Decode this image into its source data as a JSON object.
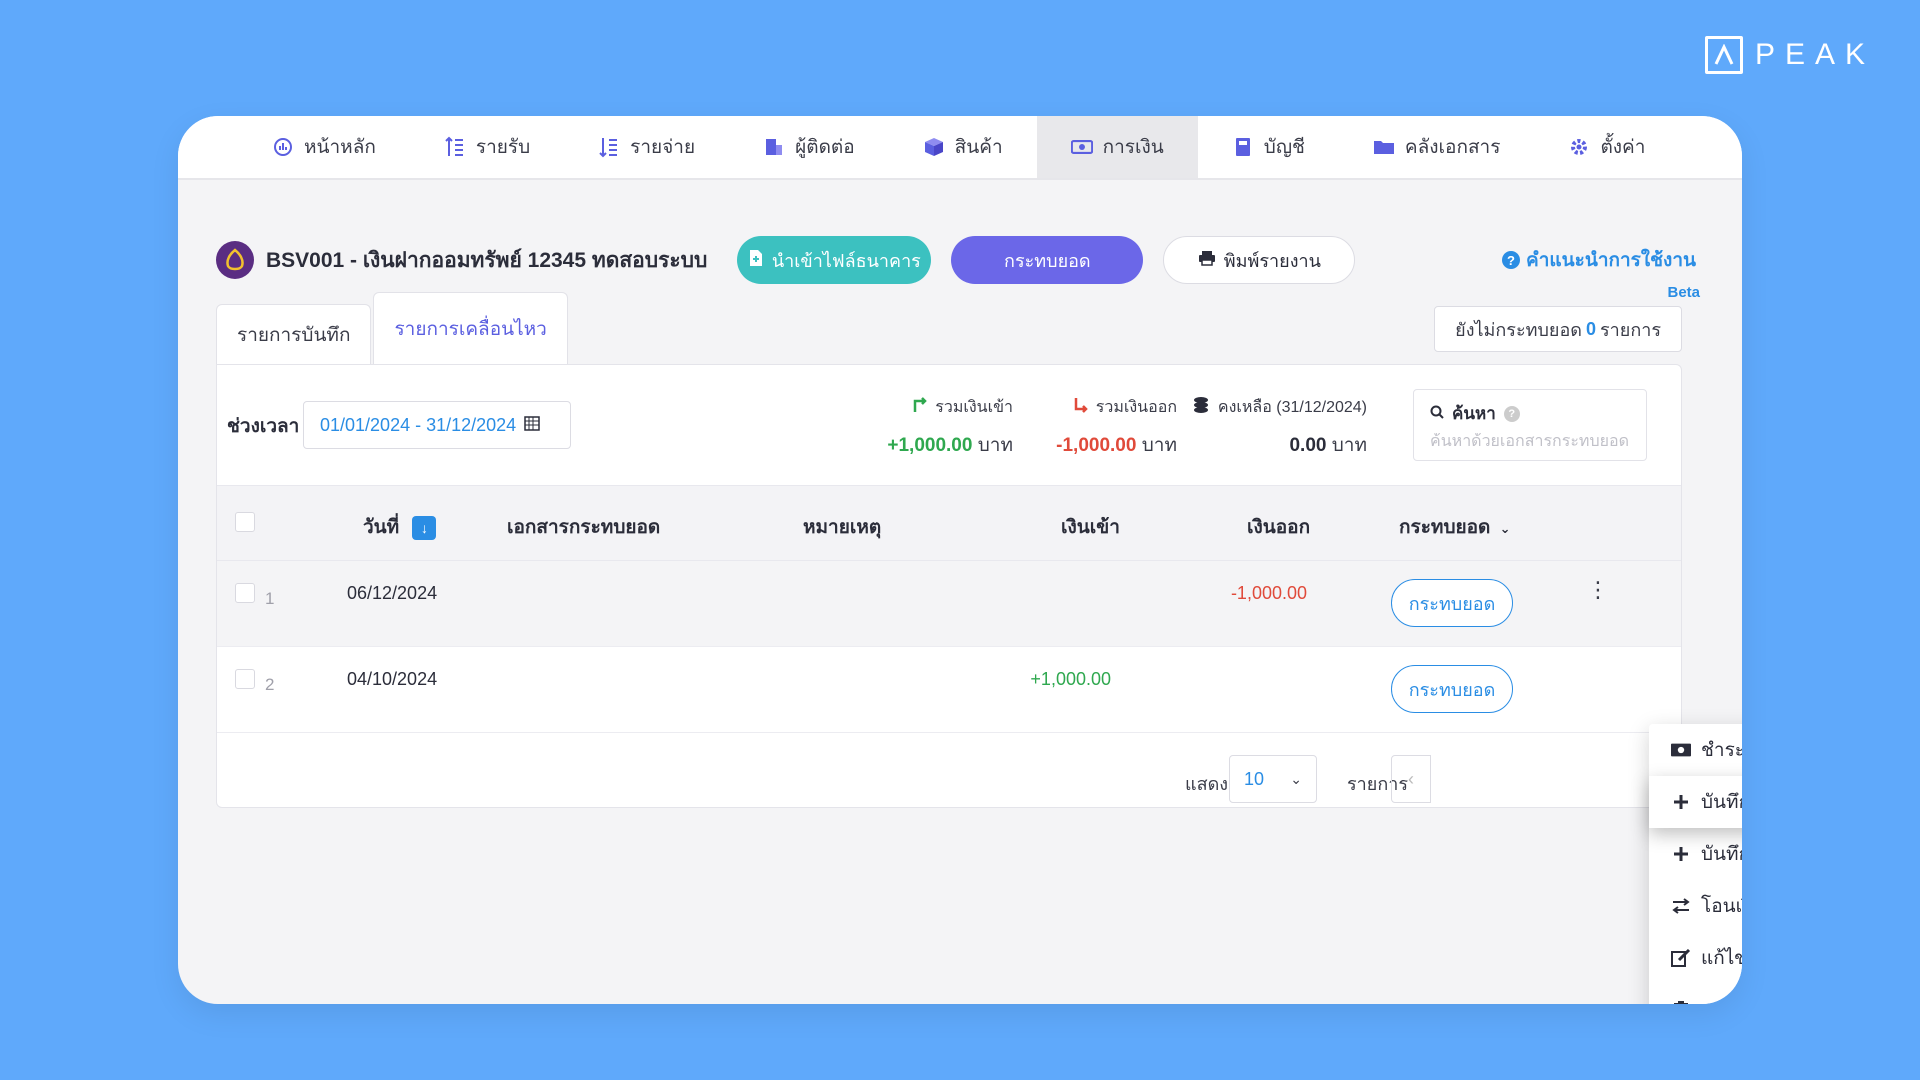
{
  "brand": {
    "name": "PEAK"
  },
  "nav": [
    {
      "label": "หน้าหลัก",
      "icon": "dashboard-icon",
      "active": false
    },
    {
      "label": "รายรับ",
      "icon": "income-list-icon",
      "active": false
    },
    {
      "label": "รายจ่าย",
      "icon": "expense-list-icon",
      "active": false
    },
    {
      "label": "ผู้ติดต่อ",
      "icon": "contacts-icon",
      "active": false
    },
    {
      "label": "สินค้า",
      "icon": "product-box-icon",
      "active": false
    },
    {
      "label": "การเงิน",
      "icon": "money-icon",
      "active": true
    },
    {
      "label": "บัญชี",
      "icon": "ledger-book-icon",
      "active": false
    },
    {
      "label": "คลังเอกสาร",
      "icon": "folder-icon",
      "active": false
    },
    {
      "label": "ตั้งค่า",
      "icon": "gear-icon",
      "active": false
    }
  ],
  "header": {
    "account_title": "BSV001 - เงินฝากออมทรัพย์ 12345 ทดสอบระบบ",
    "import_button": "นำเข้าไฟล์ธนาคาร",
    "reconcile_button": "กระทบยอด",
    "print_button": "พิมพ์รายงาน",
    "help_link": "คำแนะนำการใช้งาน",
    "beta": "Beta"
  },
  "tabs": {
    "records": "รายการบันทึก",
    "movements": "รายการเคลื่อนไหว"
  },
  "unreconciled": {
    "prefix": "ยังไม่กระทบยอด",
    "count": "0",
    "suffix": "รายการ"
  },
  "filters": {
    "period_label": "ช่วงเวลา",
    "date_range": "01/01/2024 - 31/12/2024"
  },
  "stats": {
    "total_in_label": "รวมเงินเข้า",
    "total_in_value": "+1,000.00",
    "total_out_label": "รวมเงินออก",
    "total_out_value": "-1,000.00",
    "balance_label": "คงเหลือ (31/12/2024)",
    "balance_value": "0.00",
    "currency": "บาท"
  },
  "search": {
    "label": "ค้นหา",
    "placeholder": "ค้นหาด้วยเอกสารกระทบยอด,"
  },
  "table": {
    "headers": {
      "date": "วันที่",
      "doc": "เอกสารกระทบยอด",
      "note": "หมายเหตุ",
      "in": "เงินเข้า",
      "out": "เงินออก",
      "recon": "กระทบยอด"
    },
    "rows": [
      {
        "num": "1",
        "date": "06/12/2024",
        "in": "",
        "out": "-1,000.00",
        "action": "กระทบยอด"
      },
      {
        "num": "2",
        "date": "04/10/2024",
        "in": "+1,000.00",
        "out": "",
        "action": "กระทบยอด"
      }
    ]
  },
  "pager": {
    "show_label": "แสดง",
    "page_size": "10",
    "items_label": "รายการ"
  },
  "menu": [
    {
      "label": "ชำระเงิน",
      "icon": "cash-icon"
    },
    {
      "label": "บันทึกค่าใช้จ่าย",
      "icon": "plus-icon"
    },
    {
      "label": "บันทึกซื้อสินค้า",
      "icon": "plus-icon"
    },
    {
      "label": "โอนเงิน",
      "icon": "transfer-icon"
    },
    {
      "label": "แก้ไข",
      "icon": "edit-icon"
    },
    {
      "label": "ลบ",
      "icon": "trash-icon"
    }
  ],
  "colors": {
    "background": "#5fa9fb",
    "accent_purple": "#6b67e8",
    "accent_teal": "#3cc1c0",
    "link_blue": "#2a8de4",
    "positive": "#2fa84f",
    "negative": "#e04a3a"
  }
}
